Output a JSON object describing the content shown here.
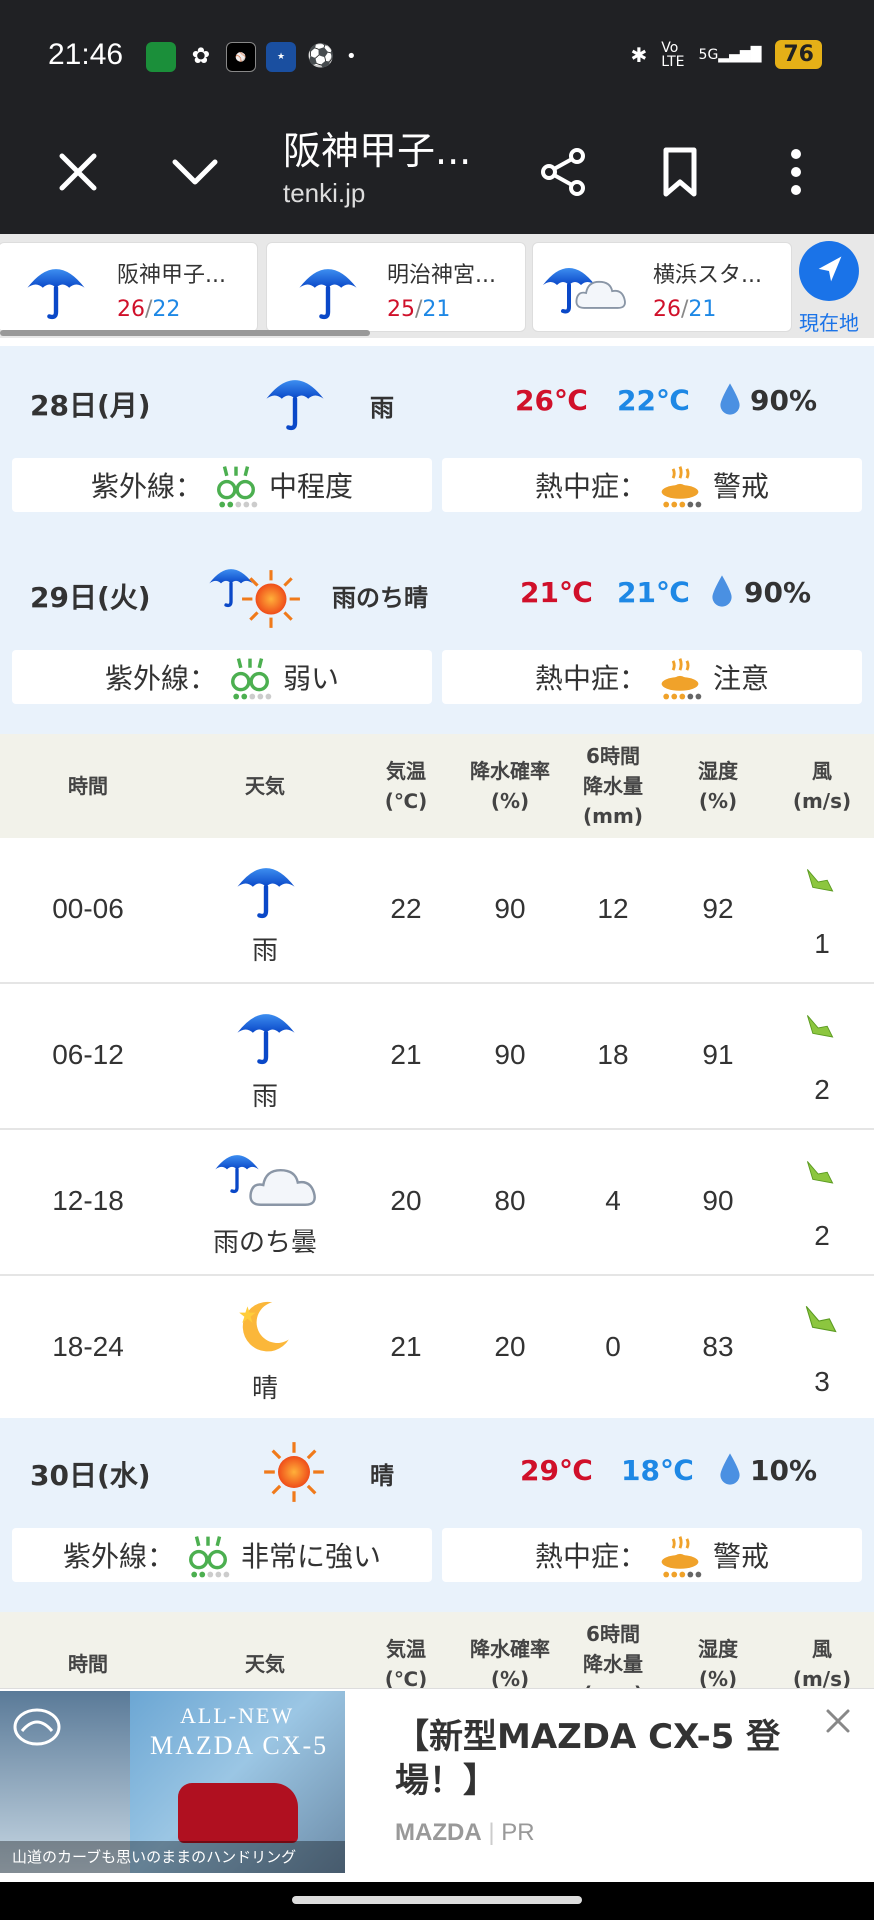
{
  "status_bar": {
    "time": "21:46",
    "battery": "76",
    "network": "5G",
    "app_icons": [
      "Uber Eats",
      "pinwheel-icon",
      "Sports",
      "baseball-icon",
      "soccer-icon"
    ]
  },
  "browser": {
    "title": "阪神甲子...",
    "url": "tenki.jp"
  },
  "locations": [
    {
      "name": "阪神甲子...",
      "high": "26",
      "low": "22",
      "icon": "umbrella-icon"
    },
    {
      "name": "明治神宮...",
      "high": "25",
      "low": "21",
      "icon": "umbrella-icon"
    },
    {
      "name": "横浜スタ...",
      "high": "26",
      "low": "21",
      "icon": "umbrella-cloud-icon"
    }
  ],
  "current_location_label": "現在地",
  "days": [
    {
      "date": "28日(月)",
      "weather": "雨",
      "high": "26℃",
      "low": "22℃",
      "precip": "90%",
      "uv_label": "紫外線：",
      "uv_value": "中程度",
      "heat_label": "熱中症：",
      "heat_value": "警戒"
    },
    {
      "date": "29日(火)",
      "weather": "雨のち晴",
      "high": "21℃",
      "low": "21℃",
      "precip": "90%",
      "uv_label": "紫外線：",
      "uv_value": "弱い",
      "heat_label": "熱中症：",
      "heat_value": "注意"
    },
    {
      "date": "30日(水)",
      "weather": "晴",
      "high": "29℃",
      "low": "18℃",
      "precip": "10%",
      "uv_label": "紫外線：",
      "uv_value": "非常に強い",
      "heat_label": "熱中症：",
      "heat_value": "警戒"
    }
  ],
  "table_header": {
    "time": "時間",
    "weather": "天気",
    "temp1": "気温",
    "temp2": "(℃)",
    "prob1": "降水確率",
    "prob2": "(%)",
    "amt1": "6時間",
    "amt2": "降水量",
    "amt3": "(mm)",
    "hum1": "湿度",
    "hum2": "(%)",
    "wind1": "風",
    "wind2": "(m/s)"
  },
  "rows": [
    {
      "time": "00-06",
      "weather": "雨",
      "temp": "22",
      "prob": "90",
      "amount": "12",
      "humidity": "92",
      "wind": "1"
    },
    {
      "time": "06-12",
      "weather": "雨",
      "temp": "21",
      "prob": "90",
      "amount": "18",
      "humidity": "91",
      "wind": "2"
    },
    {
      "time": "12-18",
      "weather": "雨のち曇",
      "temp": "20",
      "prob": "80",
      "amount": "4",
      "humidity": "90",
      "wind": "2"
    },
    {
      "time": "18-24",
      "weather": "晴",
      "temp": "21",
      "prob": "20",
      "amount": "0",
      "humidity": "83",
      "wind": "3"
    }
  ],
  "ad": {
    "image_text_top": "ALL-NEW",
    "image_text_model": "MAZDA CX-5",
    "image_caption": "山道のカーブも思いのままのハンドリング",
    "headline": "【新型MAZDA CX-5 登場！】",
    "advertiser": "MAZDA",
    "tag": "PR"
  }
}
